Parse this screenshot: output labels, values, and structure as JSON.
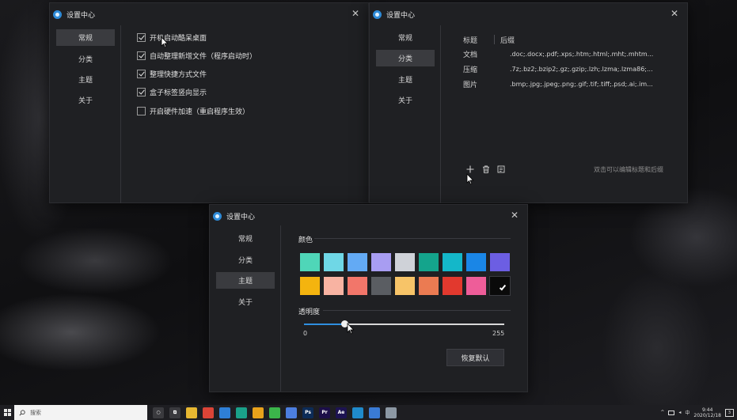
{
  "window_general": {
    "title": "设置中心",
    "nav": [
      "常规",
      "分类",
      "主题",
      "关于"
    ],
    "active_nav": "常规",
    "options": [
      {
        "label": "开机启动酷呆桌面",
        "checked": true
      },
      {
        "label": "自动整理新增文件（程序启动时）",
        "checked": true
      },
      {
        "label": "整理快捷方式文件",
        "checked": true
      },
      {
        "label": "盒子标签竖向显示",
        "checked": true
      },
      {
        "label": "开启硬件加速（重启程序生效）",
        "checked": false
      }
    ]
  },
  "window_category": {
    "title": "设置中心",
    "nav": [
      "常规",
      "分类",
      "主题",
      "关于"
    ],
    "active_nav": "分类",
    "table": {
      "headers": [
        "标题",
        "后缀"
      ],
      "rows": [
        {
          "name": "文档",
          "ext": ".doc;.docx;.pdf;.xps;.htm;.html;.mht;.mhtm..."
        },
        {
          "name": "压缩",
          "ext": ".7z;.bz2;.bzip2;.gz;.gzip;.lzh;.lzma;.lzma86;..."
        },
        {
          "name": "图片",
          "ext": ".bmp;.jpg;.jpeg;.png;.gif;.tif;.tiff;.psd;.ai;.im..."
        }
      ]
    },
    "toolbar": {
      "add_icon": "plus-icon",
      "delete_icon": "trash-icon",
      "edit_icon": "note-icon"
    },
    "hint": "双击可以编辑标题和后缀"
  },
  "window_theme": {
    "title": "设置中心",
    "nav": [
      "常规",
      "分类",
      "主题",
      "关于"
    ],
    "active_nav": "主题",
    "color_section": "颜色",
    "colors_row1": [
      "#4fd6b8",
      "#6fd7e6",
      "#63aaf4",
      "#a89df2",
      "#cfd2d8",
      "#14a48c",
      "#14b7c9",
      "#1a86e6",
      "#6c5ee3"
    ],
    "colors_row2": [
      "#f4b40f",
      "#f8b3a2",
      "#f2766a",
      "#5a5d62",
      "#f7c468",
      "#eb7b52",
      "#e2392e",
      "#ee5d99",
      "#0a0a0a"
    ],
    "selected_color": "#0a0a0a",
    "opacity_section": "透明度",
    "opacity": {
      "min": "0",
      "max": "255",
      "value": 51
    },
    "reset_button": "恢复默认"
  },
  "taskbar": {
    "search_placeholder": "搜索",
    "time": "9:44",
    "date": "2020/12/18",
    "notification_count": "3",
    "tray_caret": "^",
    "apps": [
      {
        "name": "task-view",
        "color": "#3a3a3e",
        "label": "○"
      },
      {
        "name": "task-switch",
        "color": "#3a3a3e",
        "label": "⧉"
      },
      {
        "name": "explorer",
        "color": "#e7b731",
        "label": ""
      },
      {
        "name": "chrome",
        "color": "#db4437",
        "label": ""
      },
      {
        "name": "edge-old",
        "color": "#2e7fd6",
        "label": ""
      },
      {
        "name": "edge",
        "color": "#1aa18a",
        "label": ""
      },
      {
        "name": "chrome-2",
        "color": "#e9a21b",
        "label": ""
      },
      {
        "name": "wechat",
        "color": "#3bb54a",
        "label": ""
      },
      {
        "name": "qq-drive",
        "color": "#4c7ee0",
        "label": ""
      },
      {
        "name": "photoshop",
        "color": "#0c2b57",
        "label": "Ps"
      },
      {
        "name": "premiere",
        "color": "#1c0f49",
        "label": "Pr"
      },
      {
        "name": "after-effects",
        "color": "#1d1352",
        "label": "Ae"
      },
      {
        "name": "vs-code",
        "color": "#1f8acb",
        "label": ""
      },
      {
        "name": "app-blue",
        "color": "#3a7bd5",
        "label": ""
      },
      {
        "name": "app-grey",
        "color": "#8c98a4",
        "label": ""
      }
    ]
  }
}
